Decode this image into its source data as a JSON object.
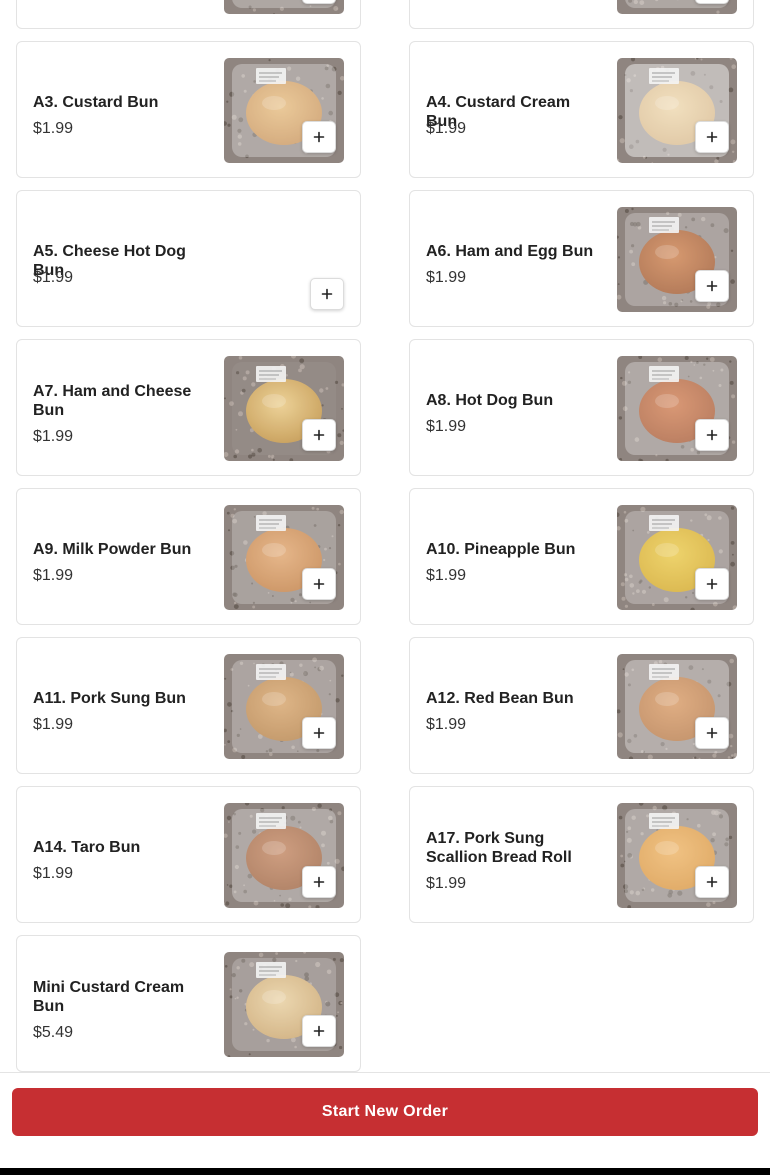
{
  "menu": {
    "items": [
      {
        "id": "A1",
        "name": "",
        "price": "",
        "has_image": true,
        "image": "bun-photo"
      },
      {
        "id": "A2",
        "name": "",
        "price": "",
        "has_image": true,
        "image": "bun-photo"
      },
      {
        "id": "A3",
        "name": "A3. Custard Bun",
        "price": "$1.99",
        "has_image": true,
        "image": "custard-bun-photo"
      },
      {
        "id": "A4",
        "name": "A4. Custard Cream Bun",
        "price": "$1.99",
        "has_image": true,
        "image": "custard-cream-bun-photo"
      },
      {
        "id": "A5",
        "name": "A5. Cheese Hot Dog Bun",
        "price": "$1.99",
        "has_image": false,
        "image": ""
      },
      {
        "id": "A6",
        "name": "A6. Ham and Egg Bun",
        "price": "$1.99",
        "has_image": true,
        "image": "ham-and-egg-bun-photo"
      },
      {
        "id": "A7",
        "name": "A7. Ham and Cheese Bun",
        "price": "$1.99",
        "has_image": true,
        "image": "ham-and-cheese-bun-photo"
      },
      {
        "id": "A8",
        "name": "A8. Hot Dog Bun",
        "price": "$1.99",
        "has_image": true,
        "image": "hot-dog-bun-photo"
      },
      {
        "id": "A9",
        "name": "A9. Milk Powder Bun",
        "price": "$1.99",
        "has_image": true,
        "image": "milk-powder-bun-photo"
      },
      {
        "id": "A10",
        "name": "A10. Pineapple Bun",
        "price": "$1.99",
        "has_image": true,
        "image": "pineapple-bun-photo"
      },
      {
        "id": "A11",
        "name": "A11. Pork Sung Bun",
        "price": "$1.99",
        "has_image": true,
        "image": "pork-sung-bun-photo"
      },
      {
        "id": "A12",
        "name": "A12. Red Bean Bun",
        "price": "$1.99",
        "has_image": true,
        "image": "red-bean-bun-photo"
      },
      {
        "id": "A14",
        "name": "A14. Taro Bun",
        "price": "$1.99",
        "has_image": true,
        "image": "taro-bun-photo"
      },
      {
        "id": "A17",
        "name": "A17. Pork Sung Scallion Bread Roll",
        "price": "$1.99",
        "has_image": true,
        "image": "pork-sung-scallion-roll-photo"
      },
      {
        "id": "MINI",
        "name": "Mini Custard Cream Bun",
        "price": "$5.49",
        "has_image": true,
        "image": "mini-custard-cream-bun-photo"
      }
    ],
    "add_icon": "plus-icon"
  },
  "footer": {
    "start_new_order_label": "Start New Order"
  },
  "colors": {
    "accent": "#c62f32",
    "card_border": "#e3e3e3",
    "text": "#222222"
  }
}
